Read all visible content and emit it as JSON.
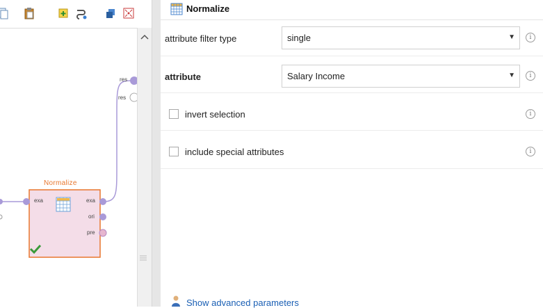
{
  "process": {
    "operator_name": "Normalize",
    "input_port": "exa",
    "output_ports": [
      "exa",
      "ori",
      "pre"
    ],
    "result_ports": [
      "res",
      "res"
    ]
  },
  "parameters": {
    "operator_name": "Normalize",
    "rows": [
      {
        "label": "attribute filter type",
        "value": "single"
      },
      {
        "label": "attribute",
        "value": "Salary Income"
      }
    ],
    "checkboxes": [
      {
        "label": "invert selection",
        "checked": false
      },
      {
        "label": "include special attributes",
        "checked": false
      }
    ],
    "advanced_link": "Show advanced parameters"
  },
  "colors": {
    "operator_title": "#e8772e",
    "operator_fill": "#f4dde8",
    "port": "#a99ad8",
    "link": "#1a5fb4",
    "check": "#3a9a3a"
  }
}
